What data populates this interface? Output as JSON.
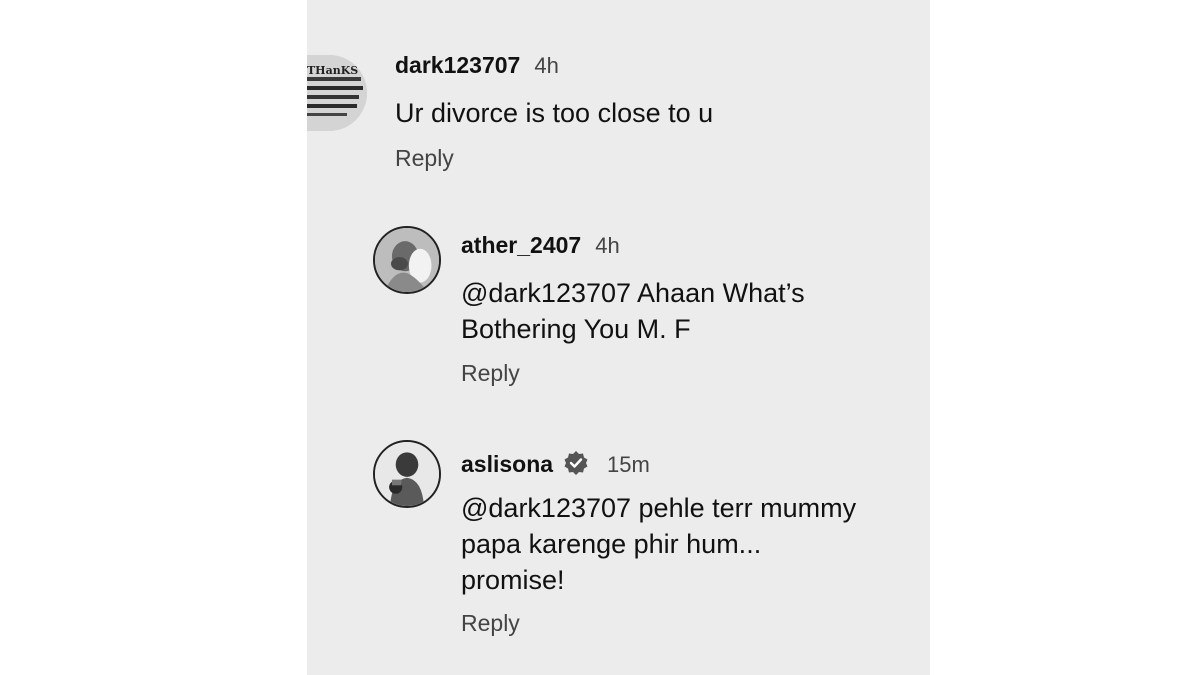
{
  "comments": [
    {
      "username": "dark123707",
      "time": "4h",
      "text": "Ur divorce is too close to u",
      "reply_label": "Reply",
      "avatar_lines": [
        "THanKS"
      ],
      "verified": false
    },
    {
      "username": "ather_2407",
      "time": "4h",
      "text_lines": [
        "@dark123707 Ahaan What’s",
        "Bothering You M. F"
      ],
      "reply_label": "Reply",
      "verified": false
    },
    {
      "username": "aslisona",
      "time": "15m",
      "text_lines": [
        "@dark123707 pehle terr mummy",
        "papa karenge phir hum...",
        "promise!"
      ],
      "reply_label": "Reply",
      "verified": true
    }
  ],
  "icons": {
    "verified": "verified-badge-icon"
  },
  "colors": {
    "background": "#ececec",
    "text": "#111111",
    "muted": "#444444"
  }
}
